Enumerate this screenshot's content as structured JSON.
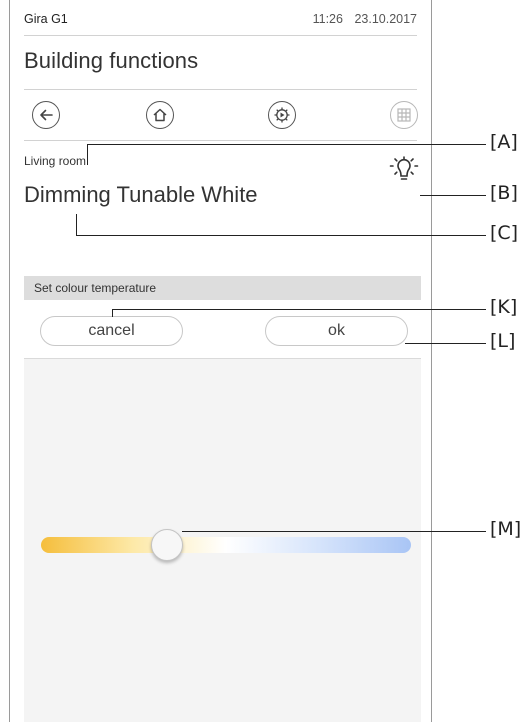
{
  "status_bar": {
    "device_name": "Gira G1",
    "time": "11:26",
    "date": "23.10.2017"
  },
  "header": {
    "title": "Building functions"
  },
  "nav": {
    "buttons": [
      {
        "name": "back",
        "icon": "arrow-left-icon"
      },
      {
        "name": "home",
        "icon": "house-icon"
      },
      {
        "name": "settings",
        "icon": "gear-icon"
      },
      {
        "name": "grid",
        "icon": "grid-icon",
        "state": "disabled"
      }
    ]
  },
  "function": {
    "room": "Living room",
    "title": "Dimming Tunable White",
    "icon": "light-bulb-icon"
  },
  "dialog": {
    "title": "Set colour temperature",
    "cancel_label": "cancel",
    "ok_label": "ok",
    "slider": {
      "value": 0.34,
      "gradient_colors": [
        "#f5be3c",
        "#fde9a8",
        "#ffffff",
        "#d6e4fb",
        "#a9c5f5"
      ]
    }
  },
  "callouts": {
    "a": "[A]",
    "b": "[B]",
    "c": "[C]",
    "k": "[K]",
    "l": "[L]",
    "m": "[M]"
  },
  "colors": {
    "panel_background": "#f4f4f4",
    "panel_header": "#dddddd",
    "text": "#333333"
  }
}
